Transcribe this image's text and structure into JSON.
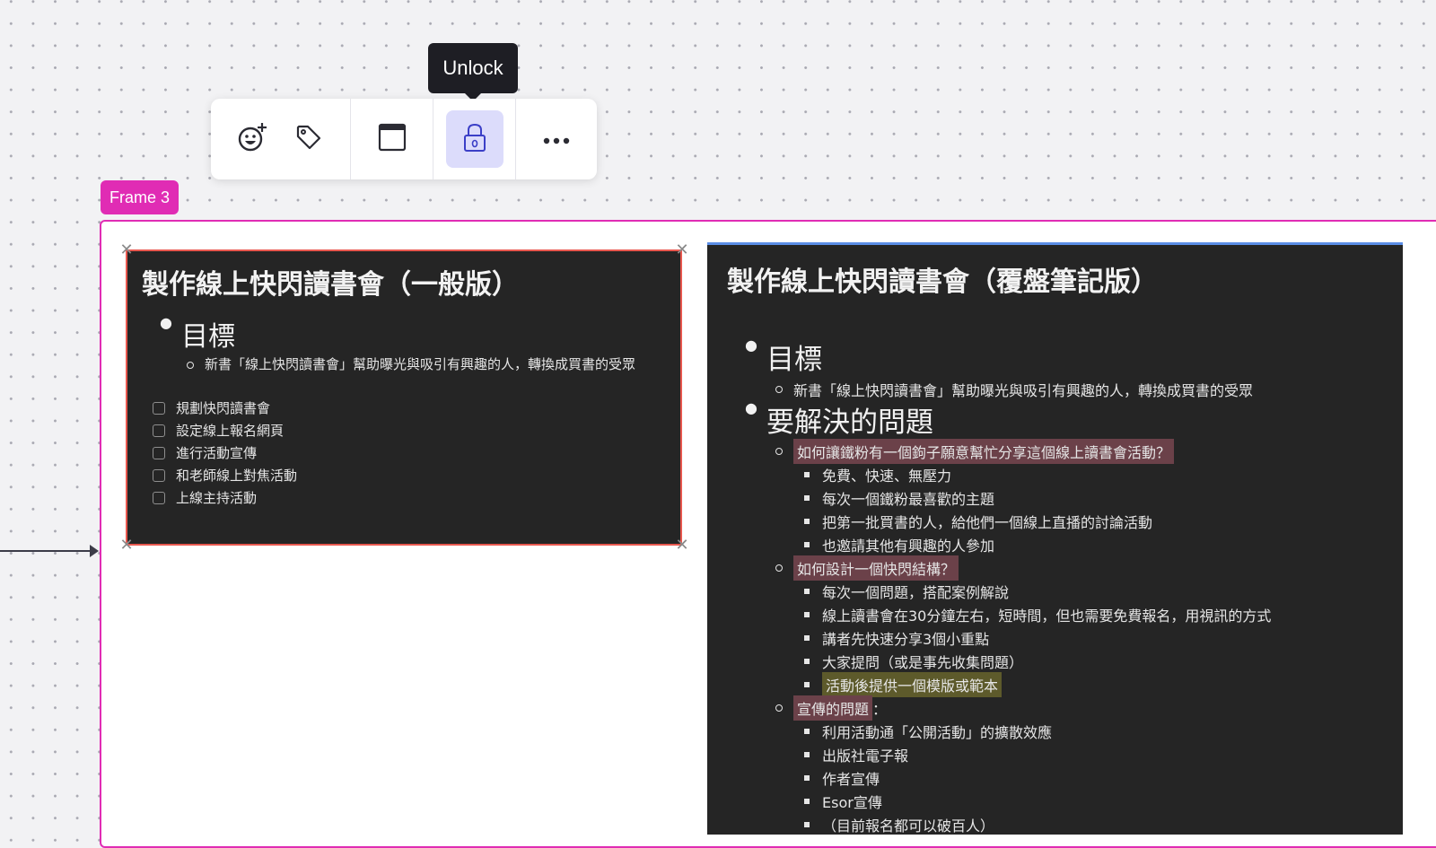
{
  "tooltip": {
    "text": "Unlock"
  },
  "toolbar": {
    "buttons": [
      {
        "icon": "add-reaction-icon"
      },
      {
        "icon": "tag-icon"
      },
      {
        "icon": "card-view-icon"
      },
      {
        "icon": "lock-icon",
        "active": true
      },
      {
        "icon": "more-icon"
      }
    ],
    "accent": "#dcdcfb"
  },
  "frame": {
    "label": "Frame 3",
    "color": "#e02cb4"
  },
  "card1": {
    "title": "製作線上快閃讀書會（一般版）",
    "heading": "目標",
    "goal": "新書「線上快閃讀書會」幫助曝光與吸引有興趣的人，轉換成買書的受眾",
    "todos": [
      "規劃快閃讀書會",
      "設定線上報名網頁",
      "進行活動宣傳",
      "和老師線上對焦活動",
      "上線主持活動"
    ],
    "border_color": "#e8584f"
  },
  "card2": {
    "title": "製作線上快閃讀書會（覆盤筆記版）",
    "heading_goal": "目標",
    "goal": "新書「線上快閃讀書會」幫助曝光與吸引有興趣的人，轉換成買書的受眾",
    "heading_problems": "要解決的問題",
    "q1": "如何讓鐵粉有一個鉤子願意幫忙分享這個線上讀書會活動？",
    "q1_items": [
      "免費、快速、無壓力",
      "每次一個鐵粉最喜歡的主題",
      "把第一批買書的人，給他們一個線上直播的討論活動",
      "也邀請其他有興趣的人參加"
    ],
    "q2": "如何設計一個快閃結構？",
    "q2_items": [
      "每次一個問題，搭配案例解說",
      "線上讀書會在30分鐘左右，短時間，但也需要免費報名，用視訊的方式",
      "講者先快速分享3個小重點",
      "大家提問（或是事先收集問題）"
    ],
    "q2_highlight_item": "活動後提供一個模版或範本",
    "q3": "宣傳的問題",
    "q3_suffix": "：",
    "q3_items": [
      "利用活動通「公開活動」的擴散效應",
      "出版社電子報",
      "作者宣傳",
      "Esor宣傳",
      "（目前報名都可以破百人）"
    ],
    "accent_top": "#5b8ee6"
  }
}
